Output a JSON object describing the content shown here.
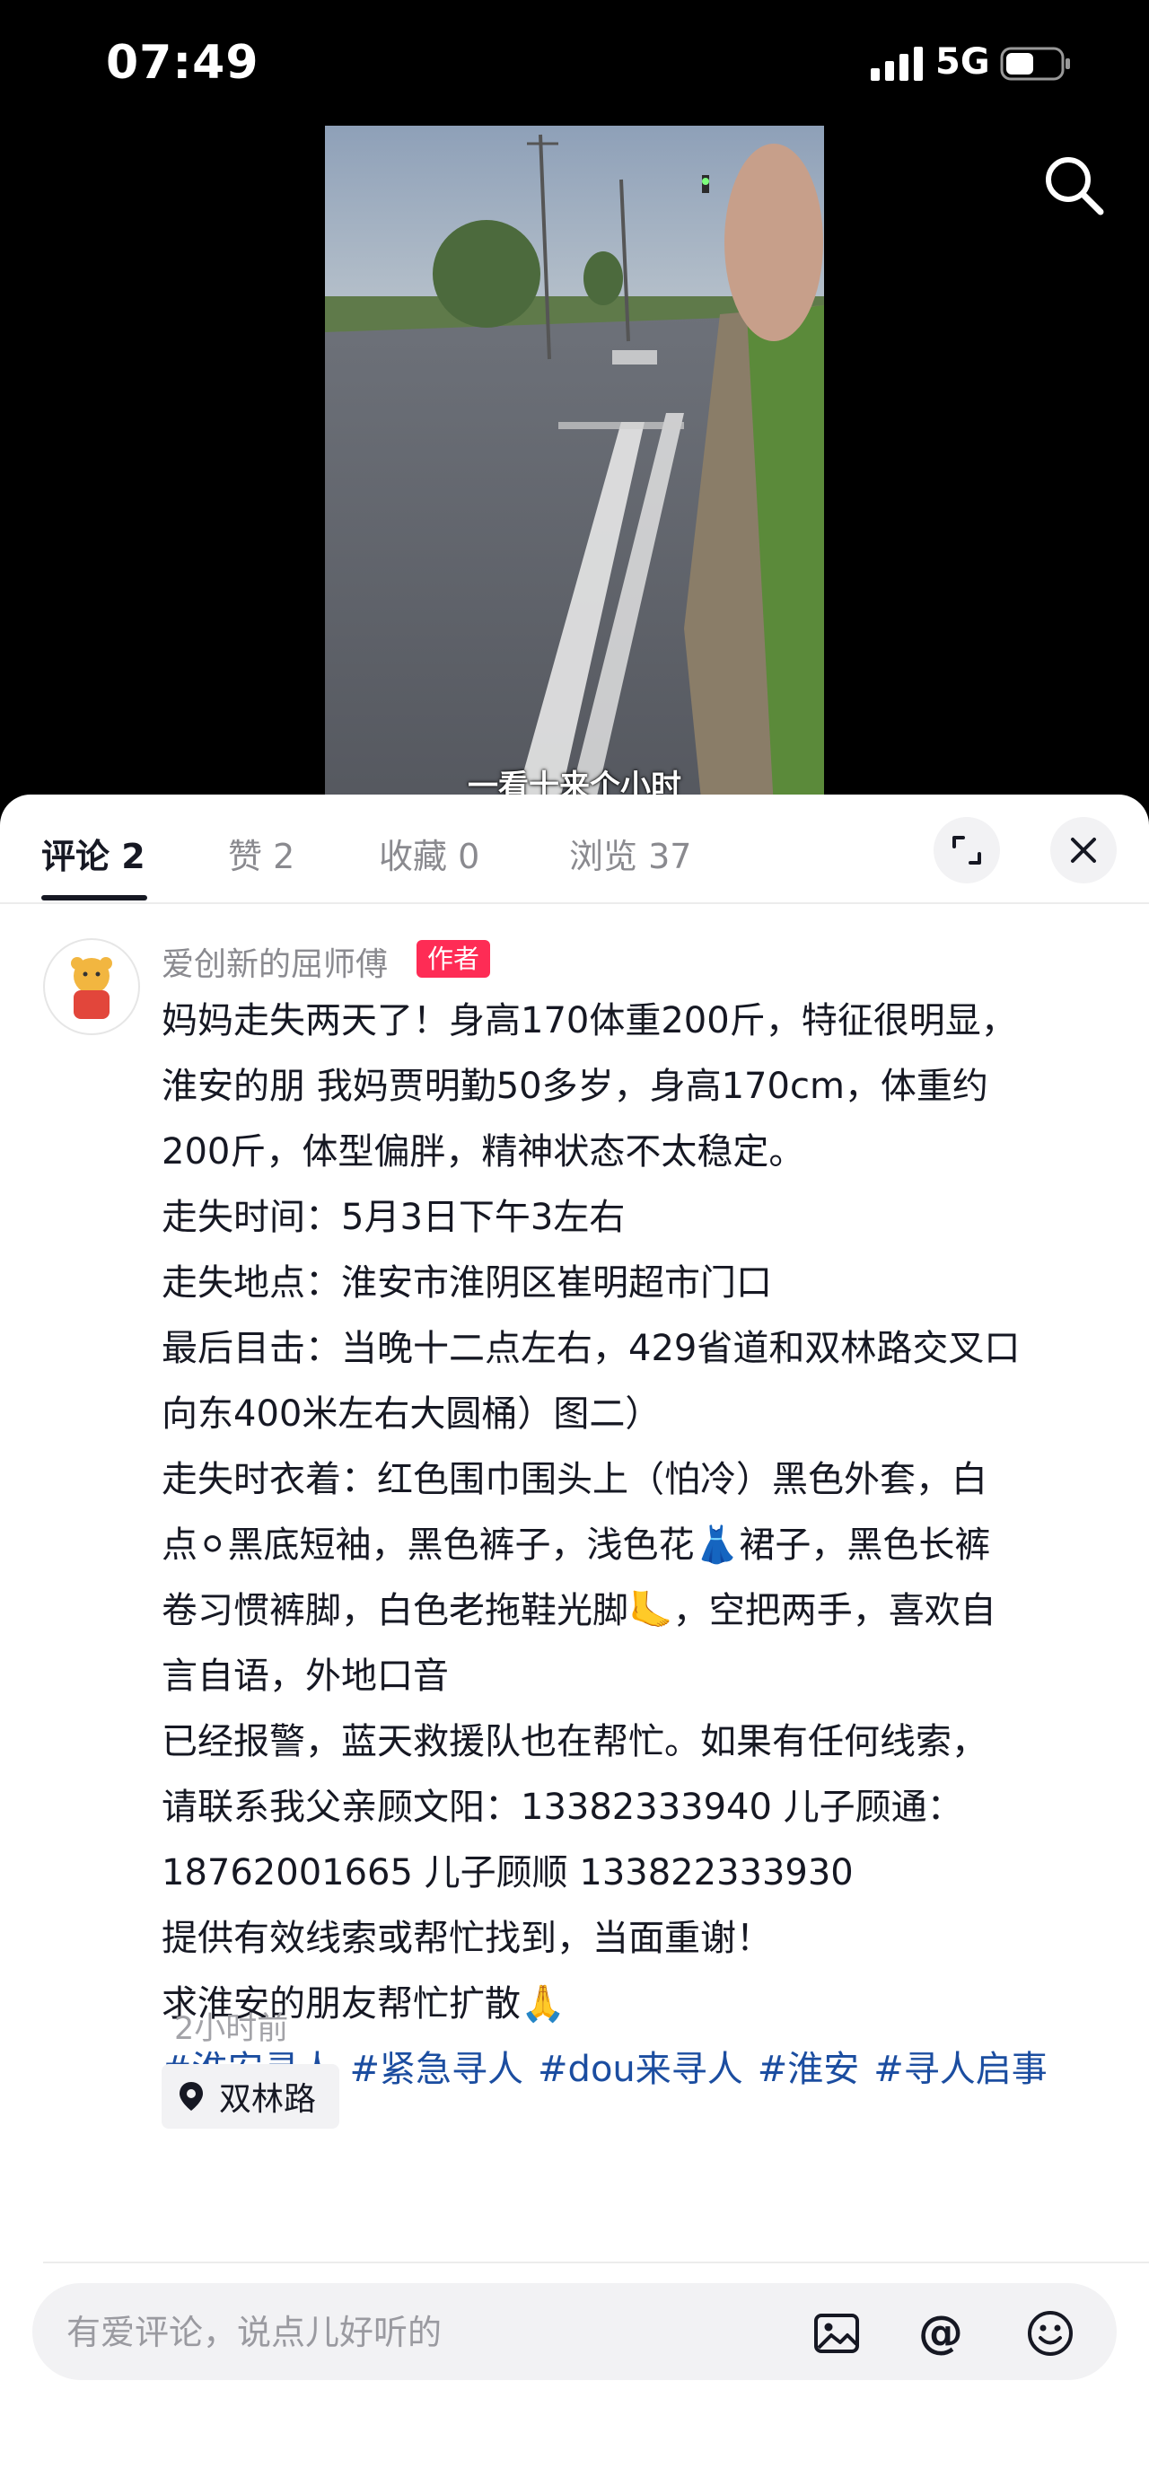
{
  "status_bar": {
    "time": "07:49",
    "network": "5G"
  },
  "video": {
    "subtitle": "一看十来个小时"
  },
  "tabs": [
    {
      "label": "评论 2"
    },
    {
      "label": "赞 2"
    },
    {
      "label": "收藏 0"
    },
    {
      "label": "浏览 37"
    }
  ],
  "comment": {
    "author": "爱创新的屈师傅",
    "badge": "作者",
    "lines": [
      "妈妈走失两天了！身高170体重200斤，特征很明显，",
      "淮安的朋 我妈贾明勤50多岁，身高170cm，体重约",
      "200斤，体型偏胖，精神状态不太稳定。",
      "走失时间：5月3日下午3左右",
      "走失地点：淮安市淮阴区崔明超市门口",
      "最后目击：当晚十二点左右，429省道和双林路交叉口",
      "向东400米左右大圆桶）图二）",
      "走失时衣着：红色围巾围头上（怕冷）黑色外套，白",
      "点⚪黑底短袖，黑色裤子，浅色花👗裙子，黑色长裤",
      "卷习惯裤脚，白色老拖鞋光脚🦶，空把两手，喜欢自",
      "言自语，外地口音",
      "已经报警，蓝天救援队也在帮忙。如果有任何线索，",
      "请联系我父亲顾文阳：13382333940 儿子顾通：",
      "18762001665 儿子顾顺 133822333930",
      "提供有效线索或帮忙找到，当面重谢！",
      "求淮安的朋友帮忙扩散🙏"
    ],
    "hashtags": [
      "#淮安寻人",
      "#紧急寻人",
      "#dou来寻人",
      "#淮安",
      "#寻人启事"
    ],
    "time_ago": "2小时前",
    "location": "双林路"
  },
  "input": {
    "placeholder": "有爱评论，说点儿好听的"
  },
  "colors": {
    "accent_badge": "#fe2c55",
    "hashtag": "#1b4da0"
  }
}
